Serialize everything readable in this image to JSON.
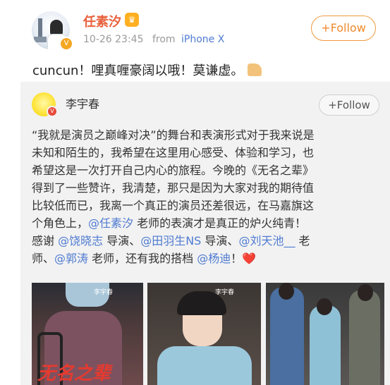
{
  "post": {
    "username": "任素汐",
    "crown_icon": "crown-badge-icon",
    "verified_icon": "verified-v-badge-icon",
    "time": "10-26 23:45",
    "source_prefix": "from",
    "device": "iPhone X",
    "follow_label": "+Follow",
    "text": "cuncun！哩真喱豪阔以哦！莫谦虚。",
    "emoji": "thumbs-up-emoji"
  },
  "repost": {
    "username": "李宇春",
    "follow_label": "+Follow",
    "lines": [
      {
        "t": "“我就是演员之巅峰对决”的舞台和表演形式对于我来说是"
      },
      {
        "t": "未知和陌生的，我希望在这里用心感受、体验和学习，也"
      },
      {
        "t": "希望这是一次打开自己内心的旅程。今晚的《无名之辈》"
      },
      {
        "t": "得到了一些赞许，我清楚，那只是因为大家对我的期待值"
      },
      {
        "t": "比较低而已，我离一个真正的演员还差很远，在马嘉旗这"
      },
      {
        "a": "个角色上，",
        "m1": "@任素汐",
        "b": " 老师的表演才是真正的炉火纯青！"
      },
      {
        "a": "感谢 ",
        "m1": "@饶晓志",
        "b": " 导演、",
        "m2": "@田羽生NS",
        "c": " 导演、",
        "m3": "@刘天池__",
        "d": "  老"
      },
      {
        "a": "师、",
        "m1": "@郭涛",
        "b": " 老师，还有我的搭档 ",
        "m2": "@杨迪",
        "c": "！",
        "heart": "❤️"
      }
    ],
    "photos": [
      {
        "caption": "李宇春",
        "brand": "无名之辈"
      },
      {
        "caption": "李宇春"
      },
      {}
    ]
  }
}
